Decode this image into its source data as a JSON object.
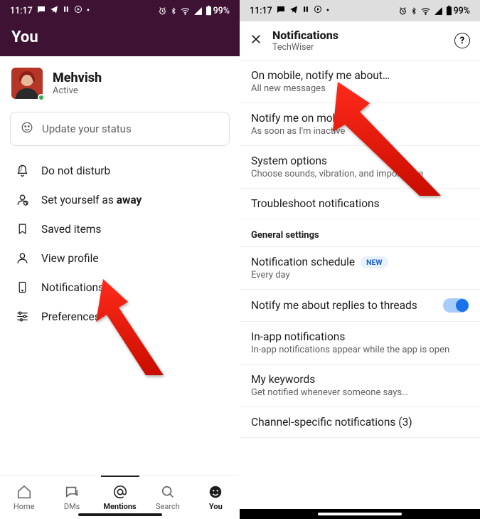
{
  "left": {
    "statusbar": {
      "time": "11:17",
      "battery": "99%"
    },
    "title": "You",
    "profile": {
      "name": "Mehvish",
      "status": "Active"
    },
    "status_button": {
      "placeholder": "Update your status"
    },
    "menu": [
      {
        "label": "Do not disturb"
      },
      {
        "label_prefix": "Set yourself as ",
        "label_bold": "away"
      },
      {
        "label": "Saved items"
      },
      {
        "label": "View profile"
      },
      {
        "label": "Notifications"
      },
      {
        "label": "Preferences"
      }
    ],
    "bottombar": {
      "home": "Home",
      "dms": "DMs",
      "mentions": "Mentions",
      "search": "Search",
      "you": "You"
    }
  },
  "right": {
    "statusbar": {
      "time": "11:17",
      "battery": "99%"
    },
    "header": {
      "title": "Notifications",
      "subtitle": "TechWiser"
    },
    "rows": {
      "r1": {
        "title": "On mobile, notify me about…",
        "sub": "All new messages"
      },
      "r2": {
        "title": "Notify me on mobile…",
        "sub": "As soon as I'm inactive"
      },
      "r3": {
        "title": "System options",
        "sub": "Choose sounds, vibration, and importance"
      },
      "r4": {
        "title": "Troubleshoot notifications"
      }
    },
    "general_header": "General settings",
    "g1": {
      "title": "Notification schedule",
      "badge": "NEW",
      "sub": "Every day"
    },
    "g2": {
      "title": "Notify me about replies to threads"
    },
    "g3": {
      "title": "In-app notifications",
      "sub": "In-app notifications appear while the app is open"
    },
    "g4": {
      "title": "My keywords",
      "sub": "Get notified whenever someone says…"
    },
    "g5": {
      "title": "Channel-specific notifications (3)"
    }
  }
}
